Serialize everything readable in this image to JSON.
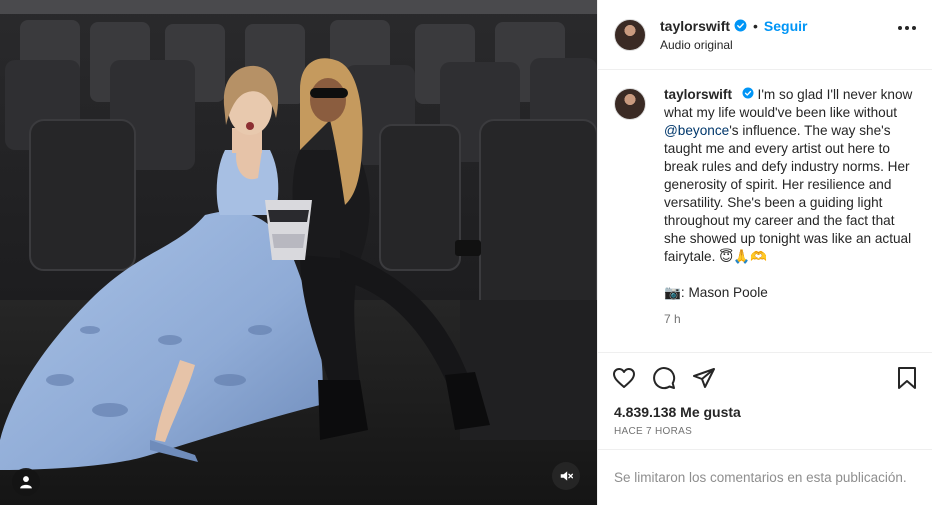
{
  "post": {
    "username": "taylorswift",
    "follow_label": "Seguir",
    "separator": "•",
    "audio_label": "Audio original",
    "caption": {
      "text_before_mention": "I'm so glad I'll never know what my life would've been like without ",
      "mention": "@beyonce",
      "text_after_mention": "'s influence. The way she's taught me and every artist out here to break rules and defy industry norms. Her generosity of spirit. Her resilience and versatility. She's been a guiding light throughout my career and the fact that she showed up tonight was like an actual fairytale. 😇🙏🫶",
      "credit": "📷: Mason Poole"
    },
    "time_ago": "7 h",
    "likes": "4.839.138 Me gusta",
    "posted_ago": "HACE 7 HORAS",
    "comments_disabled": "Se limitaron los comentarios en esta publicación."
  },
  "icons": {
    "verified": "verified-badge-icon",
    "more": "more-options-icon",
    "like": "heart-icon",
    "comment": "comment-icon",
    "share": "share-icon",
    "save": "bookmark-icon",
    "mute": "muted-speaker-icon",
    "tagged": "user-tag-icon"
  },
  "colors": {
    "accent": "#0095f6",
    "mention": "#00376b",
    "verified": "#0095f6",
    "muted_text": "#737373"
  }
}
